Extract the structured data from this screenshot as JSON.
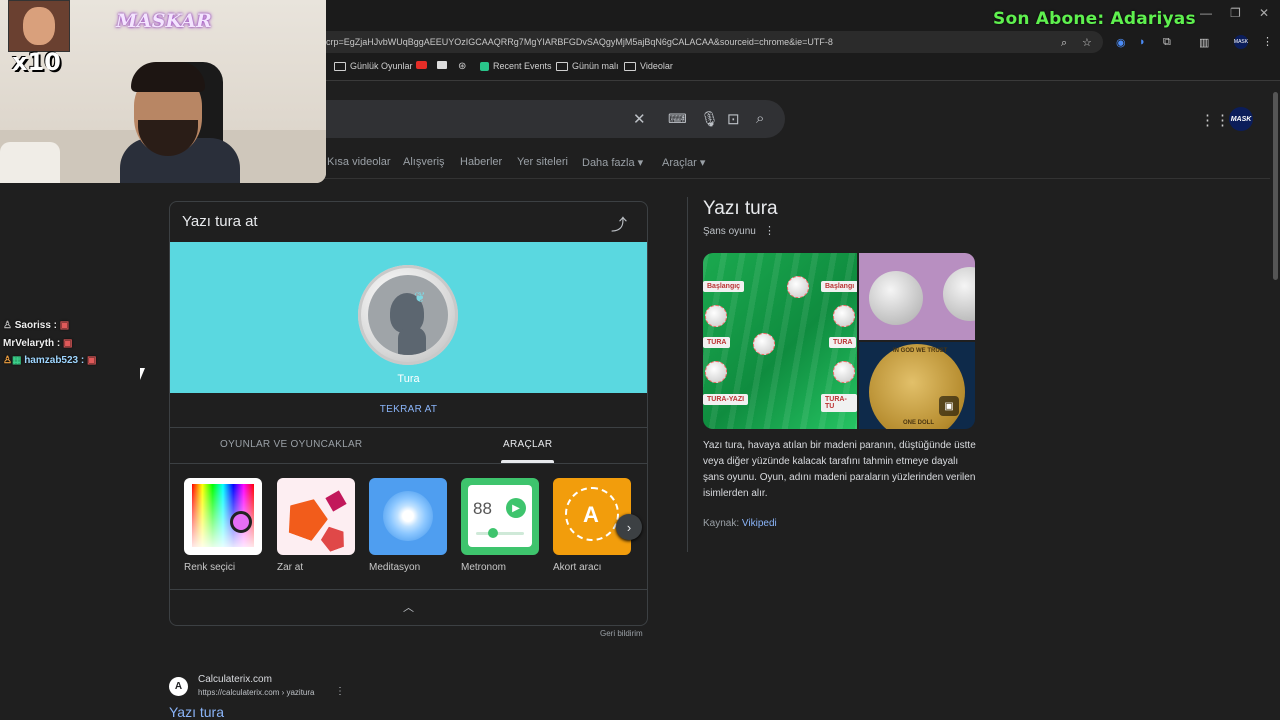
{
  "overlay": {
    "son_abone": "Son Abone: Adariyas",
    "multiplier": "x10",
    "streamer_logo": "MASKAR",
    "chat": [
      {
        "user": "Saoriss :"
      },
      {
        "user": "MrVelaryth :"
      },
      {
        "user": "hamzab523 :"
      }
    ]
  },
  "browser": {
    "url": "crp=EgZjaHJvbWUqBggAEEUYOzIGCAAQRRg7MgYIARBFGDvSAQgyMjM5ajBqN6gCALACAA&sourceid=chrome&ie=UTF-8",
    "bookmarks": [
      {
        "label": "Günlük Oyunlar",
        "icon": "folder-icon"
      },
      {
        "label": "",
        "icon": "youtube-icon"
      },
      {
        "label": "",
        "icon": "media-icon"
      },
      {
        "label": "",
        "icon": "chatgpt-icon"
      },
      {
        "label": "Recent Events",
        "icon": "streamelements-icon"
      },
      {
        "label": "Günün malı",
        "icon": "folder-icon"
      },
      {
        "label": "Videolar",
        "icon": "folder-icon"
      }
    ],
    "profile_initials": "MASK"
  },
  "search": {
    "tabs": [
      "Kısa videolar",
      "Alışveriş",
      "Haberler",
      "Yer siteleri",
      "Daha fazla ▾",
      "Araçlar ▾"
    ]
  },
  "coin_card": {
    "title": "Yazı tura at",
    "result": "Tura",
    "flip_again": "TEKRAR AT",
    "category_tabs": [
      "OYUNLAR VE OYUNCAKLAR",
      "ARAÇLAR"
    ],
    "active_tab": "ARAÇLAR",
    "tools": [
      {
        "label": "Renk seçici",
        "icon": "color-picker-icon"
      },
      {
        "label": "Zar at",
        "icon": "dice-icon"
      },
      {
        "label": "Meditasyon",
        "icon": "meditation-icon"
      },
      {
        "label": "Metronom",
        "icon": "metronome-icon"
      },
      {
        "label": "Akort aracı",
        "icon": "tuner-icon"
      }
    ],
    "metronome_value": "88",
    "tuner_letter": "A",
    "feedback": "Geri bildirim"
  },
  "knowledge_panel": {
    "title": "Yazı tura",
    "subtitle": "Şans oyunu",
    "description": "Yazı tura, havaya atılan bir madeni paranın, düştüğünde üstte veya diğer yüzünde kalacak tarafını tahmin etmeye dayalı şans oyunu. Oyun, adını madeni paraların yüzlerinden verilen isimlerden alır.",
    "source_label": "Kaynak:",
    "source_link": "Vikipedi",
    "image_labels": [
      "Başlangıç",
      "Başlangı",
      "TURA",
      "TURA",
      "TURA-YAZI",
      "TURA-TU"
    ],
    "coin_text": "IN GOD WE TRUST",
    "coin_bottom": "ONE DOLL"
  },
  "result": {
    "site": "Calculaterix.com",
    "url": "https://calculaterix.com › yazitura",
    "title": "Yazı tura"
  }
}
